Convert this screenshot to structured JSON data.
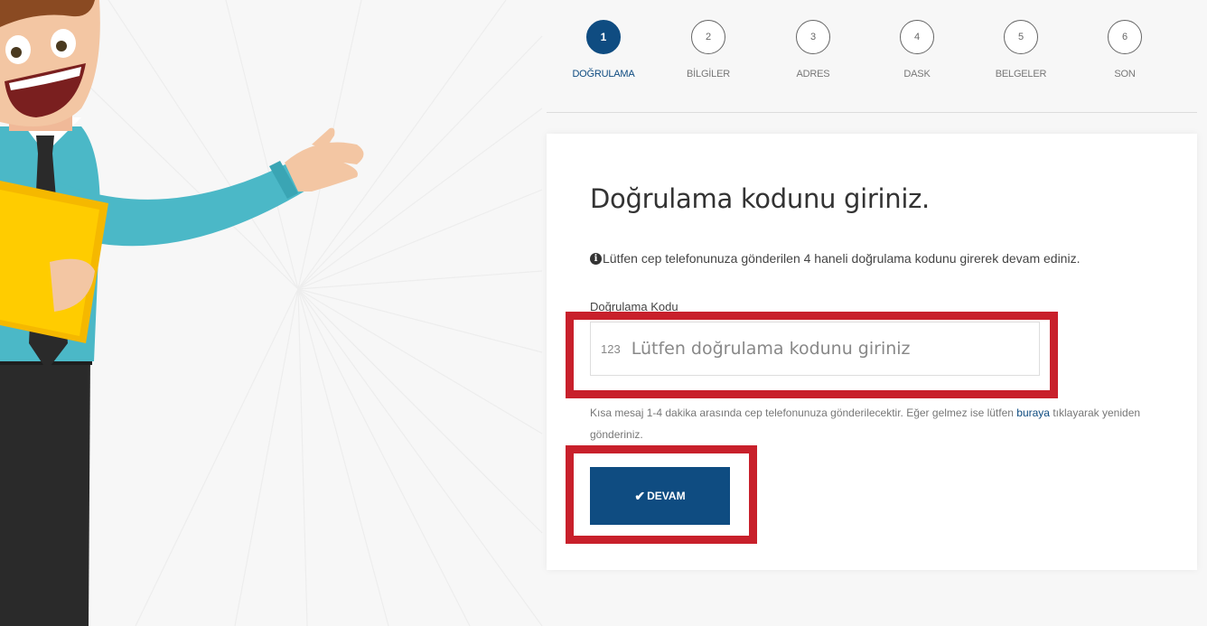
{
  "steps": [
    {
      "number": "1",
      "label": "DOĞRULAMA",
      "active": true
    },
    {
      "number": "2",
      "label": "BİLGİLER",
      "active": false
    },
    {
      "number": "3",
      "label": "ADRES",
      "active": false
    },
    {
      "number": "4",
      "label": "DASK",
      "active": false
    },
    {
      "number": "5",
      "label": "BELGELER",
      "active": false
    },
    {
      "number": "6",
      "label": "SON",
      "active": false
    }
  ],
  "verification": {
    "title": "Doğrulama kodunu giriniz.",
    "info_text": "Lütfen cep telefonunuza gönderilen 4 haneli doğrulama kodunu girerek devam ediniz.",
    "field_label": "Doğrulama Kodu",
    "input_prefix": "123",
    "input_placeholder": "Lütfen doğrulama kodunu giriniz",
    "input_value": "",
    "helper_text_before": "Kısa mesaj 1-4 dakika arasında cep telefonunuza gönderilecektir. Eğer gelmez ise lütfen ",
    "helper_link": "buraya",
    "helper_text_after": " tıklayarak yeniden gönderiniz.",
    "submit_icon": "check-icon",
    "submit_label": "DEVAM"
  },
  "colors": {
    "primary": "#0f4c81",
    "highlight": "#c8202b",
    "step_inactive": "#666666"
  }
}
